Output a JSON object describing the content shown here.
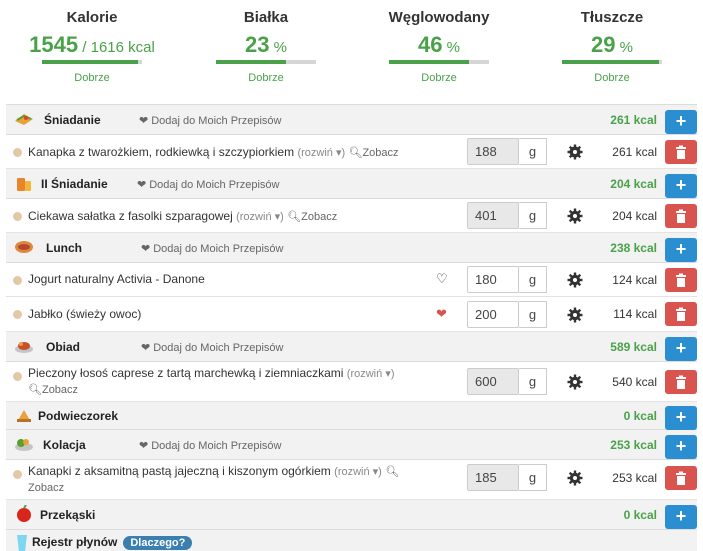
{
  "summary": [
    {
      "title": "Kalorie",
      "value": "1545",
      "suffix": " / 1616 kcal",
      "status": "Dobrze",
      "progress": 0.96
    },
    {
      "title": "Białka",
      "value": "23",
      "suffix": " %",
      "status": "Dobrze",
      "progress": 0.7
    },
    {
      "title": "Węglowodany",
      "value": "46",
      "suffix": " %",
      "status": "Dobrze",
      "progress": 0.8
    },
    {
      "title": "Tłuszcze",
      "value": "29",
      "suffix": " %",
      "status": "Dobrze",
      "progress": 0.97
    }
  ],
  "fav_label": "Dodaj do Moich Przepisów",
  "unit": "g",
  "expand_label": "(rozwiń ▾)",
  "see_label": "Zobacz",
  "meals": {
    "breakfast": {
      "name": "Śniadanie",
      "kcal": "261 kcal",
      "items": [
        {
          "name": "Kanapka z twarożkiem, rodkiewką i szczypiorkiem",
          "qty": "188",
          "kcal": "261 kcal"
        }
      ]
    },
    "breakfast2": {
      "name": "II Śniadanie",
      "kcal": "204 kcal",
      "items": [
        {
          "name": "Ciekawa sałatka z fasolki szparagowej",
          "qty": "401",
          "kcal": "204 kcal"
        }
      ]
    },
    "lunch": {
      "name": "Lunch",
      "kcal": "238 kcal",
      "items": [
        {
          "name": "Jogurt naturalny Activia - Danone",
          "qty": "180",
          "kcal": "124 kcal"
        },
        {
          "name": "Jabłko (świeży owoc)",
          "qty": "200",
          "kcal": "114 kcal"
        }
      ]
    },
    "dinner": {
      "name": "Obiad",
      "kcal": "589 kcal",
      "items": [
        {
          "name": "Pieczony łosoś caprese z tartą marchewką i ziemniaczkami",
          "qty": "600",
          "kcal": "540 kcal"
        }
      ]
    },
    "snack": {
      "name": "Podwieczorek",
      "kcal": "0 kcal"
    },
    "supper": {
      "name": "Kolacja",
      "kcal": "253 kcal",
      "items": [
        {
          "name": "Kanapki z aksamitną pastą jajeczną i kiszonym ogórkiem",
          "qty": "185",
          "kcal": "253 kcal"
        }
      ]
    },
    "extras": {
      "name": "Przekąski",
      "kcal": "0 kcal"
    },
    "fluids": {
      "name": "Rejestr płynów",
      "badge": "Dlaczego?"
    }
  }
}
